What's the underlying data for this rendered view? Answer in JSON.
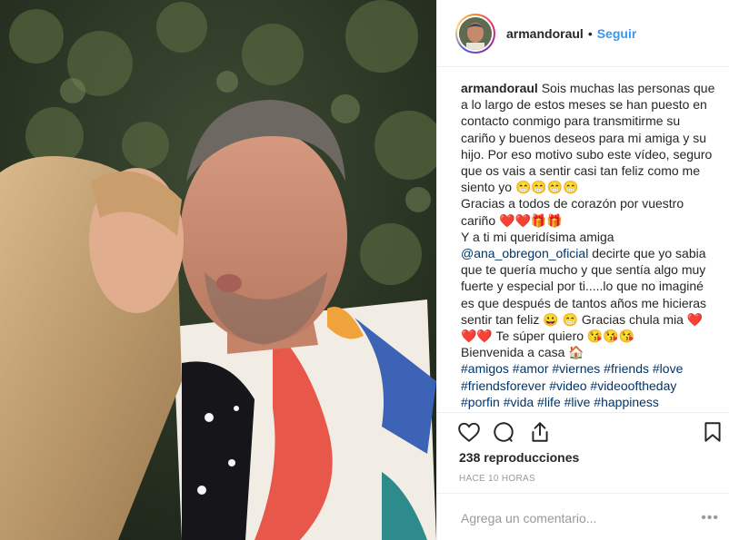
{
  "post": {
    "username": "armandoraul",
    "separator": "•",
    "follow_label": "Seguir",
    "caption": {
      "username": "armandoraul",
      "p1": "Sois muchas las personas que a lo largo de estos meses se han puesto en contacto conmigo para transmitirme su cariño y buenos deseos para mi amiga y su hijo. Por eso motivo subo este vídeo, seguro que os vais a sentir casi tan feliz como me siento yo",
      "p1_emoji": "😁😁😁😁",
      "p2": "Gracias a todos de corazón por vuestro cariño",
      "p2_emoji": "❤️❤️🎁🎁",
      "p3_a": "Y a ti mi queridísima amiga",
      "mention": "@ana_obregon_oficial",
      "p3_b": "decirte que yo sabia que te quería mucho y que sentía algo muy fuerte y especial por ti.....lo que no imaginé es que después de tantos años me hicieras sentir tan feliz",
      "p3_emoji": "😀 😁",
      "p3_c": "Gracias chula mia",
      "p3_hearts": "❤️ ❤️❤️",
      "p4": "Te súper quiero",
      "p4_emoji": "😘😘😘",
      "p5": "Bienvenida a casa",
      "p5_emoji": "🏠",
      "hashtags_1": "#amigos #amor #viernes #friends #love",
      "hashtags_2": "#friendsforever #video #videooftheday",
      "hashtags_3": "#porfin #vida #life #live #happiness"
    },
    "views": "238 reproducciones",
    "time": "HACE 10 HORAS",
    "comment_placeholder": "Agrega un comentario...",
    "more": "•••"
  },
  "icons": {
    "like": "heart-outline-icon",
    "comment": "speech-bubble-icon",
    "share": "share-upload-icon",
    "save": "bookmark-icon"
  },
  "colors": {
    "follow": "#3897f0",
    "link": "#003569",
    "muted": "#999999",
    "border": "#efefef"
  }
}
